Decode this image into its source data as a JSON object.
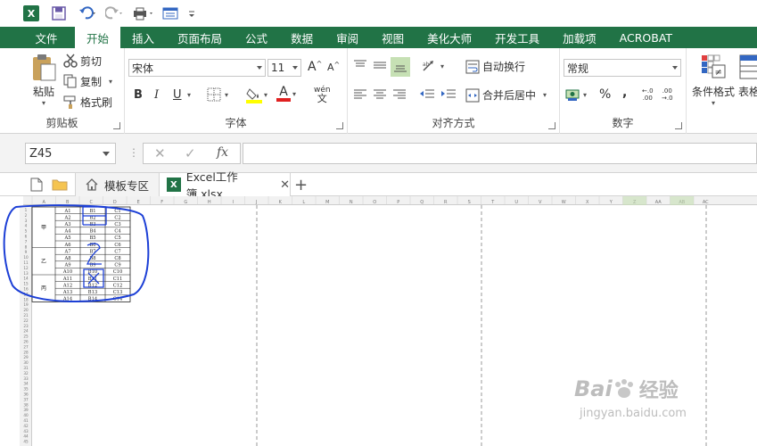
{
  "quick_access": {
    "icons": [
      "excel-logo-icon",
      "save-icon",
      "undo-icon",
      "redo-icon",
      "print-preview-icon",
      "form-icon",
      "customize-icon"
    ],
    "logo_text": "X"
  },
  "tabs": [
    {
      "label": "文件"
    },
    {
      "label": "开始"
    },
    {
      "label": "插入"
    },
    {
      "label": "页面布局"
    },
    {
      "label": "公式"
    },
    {
      "label": "数据"
    },
    {
      "label": "审阅"
    },
    {
      "label": "视图"
    },
    {
      "label": "美化大师"
    },
    {
      "label": "开发工具"
    },
    {
      "label": "加载项"
    },
    {
      "label": "ACROBAT"
    }
  ],
  "ribbon": {
    "clipboard": {
      "paste": "粘贴",
      "cut": "剪切",
      "copy": "复制",
      "format_painter": "格式刷",
      "label": "剪贴板"
    },
    "font": {
      "font_name": "宋体",
      "font_size": "11",
      "grow": "A",
      "shrink": "A",
      "bold": "B",
      "italic": "I",
      "underline": "U",
      "font_color_letter": "A",
      "wen": "wén",
      "wen_char": "文",
      "label": "字体"
    },
    "alignment": {
      "wrap_text": "自动换行",
      "merge_center": "合并后居中",
      "label": "对齐方式"
    },
    "number": {
      "format": "常规",
      "percent": "%",
      "comma": ",",
      "inc_decimal": "←.0\n.00",
      "dec_decimal": ".00\n→.0",
      "label": "数字"
    },
    "styles": {
      "conditional_format": "条件格式",
      "table_format_partial": "表格"
    }
  },
  "formula_bar": {
    "name_box": "Z45",
    "fx": "fx",
    "formula": ""
  },
  "doc_tabs": {
    "template_zone": "模板专区",
    "workbook": "Excel工作簿.xlsx",
    "add": "+"
  },
  "sheet": {
    "col_letters": [
      "A",
      "B",
      "C",
      "D",
      "E",
      "F",
      "G",
      "H",
      "I",
      "J",
      "K",
      "L",
      "M",
      "N",
      "O",
      "P",
      "Q",
      "R",
      "S",
      "T",
      "U",
      "V",
      "W",
      "X",
      "Y",
      "Z",
      "AA",
      "AB",
      "AC"
    ],
    "row_count": 45,
    "table": {
      "groups": [
        "甲",
        "乙",
        "丙"
      ],
      "rows": [
        [
          "A1",
          "B1",
          "C1"
        ],
        [
          "A2",
          "B2",
          "C2"
        ],
        [
          "A3",
          "B3",
          "C3"
        ],
        [
          "A4",
          "B4",
          "C4"
        ],
        [
          "A5",
          "B5",
          "C5"
        ],
        [
          "A6",
          "B6",
          "C6"
        ],
        [
          "A7",
          "B7",
          "C7"
        ],
        [
          "A8",
          "B8",
          "C8"
        ],
        [
          "A9",
          "B9",
          "C9"
        ],
        [
          "A10",
          "B10",
          "C10"
        ],
        [
          "A11",
          "B11",
          "C11"
        ],
        [
          "A12",
          "B12",
          "C12"
        ],
        [
          "A13",
          "B13",
          "C13"
        ],
        [
          "A14",
          "B14",
          "C14"
        ]
      ]
    }
  },
  "watermark": {
    "brand": "Bai",
    "brand2": "经验",
    "url": "jingyan.baidu.com"
  },
  "colors": {
    "excel_green": "#217346",
    "annotation_blue": "#1c3fd6",
    "font_highlight": "#ffff00",
    "font_color": "#e02020"
  }
}
